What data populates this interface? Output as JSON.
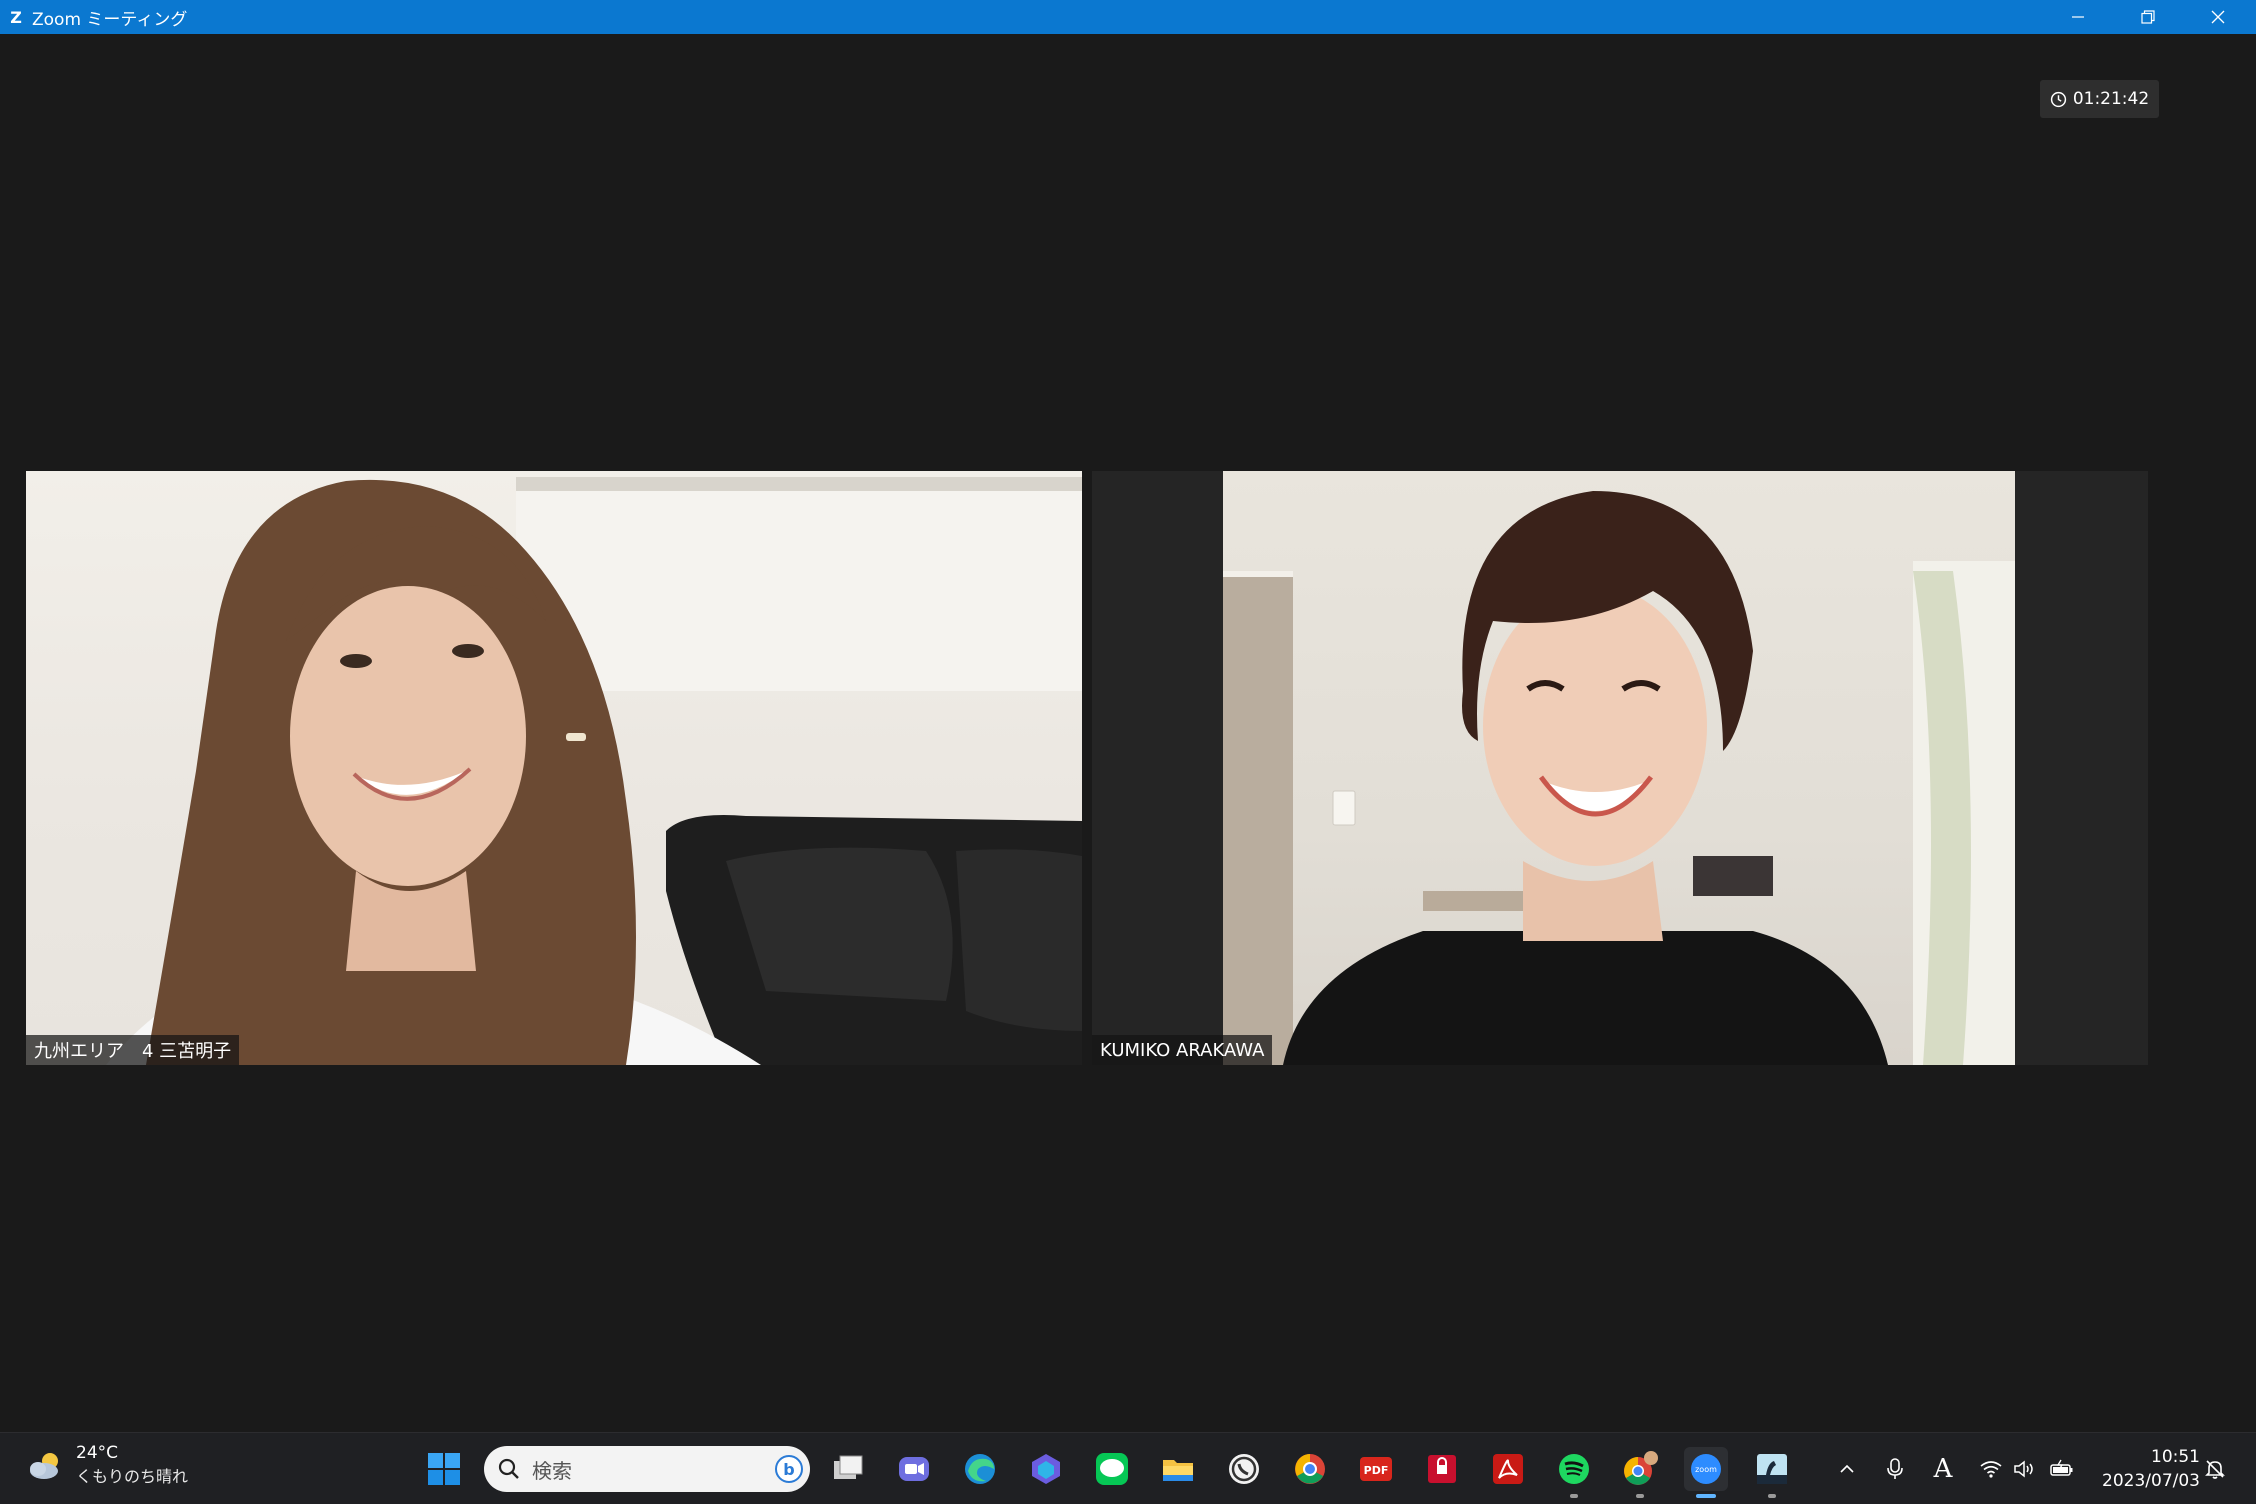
{
  "window": {
    "app_logo": "Z",
    "title": "Zoom ミーティング"
  },
  "meeting": {
    "timer": "01:21:42",
    "participants": [
      {
        "name": "九州エリア　4 三苫明子"
      },
      {
        "name": "KUMIKO ARAKAWA"
      }
    ]
  },
  "taskbar": {
    "weather": {
      "temp": "24°C",
      "condition": "くもりのち晴れ"
    },
    "search_placeholder": "検索",
    "clock": {
      "time": "10:51",
      "date": "2023/07/03"
    },
    "ime_indicator": "A",
    "apps": [
      "start",
      "search",
      "task-view",
      "teams",
      "edge",
      "copilot",
      "line",
      "file-explorer",
      "whatsapp",
      "chrome",
      "pdf",
      "mcafee",
      "acrobat",
      "spotify",
      "chrome-profile",
      "zoom",
      "kindle"
    ],
    "pdf_label": "PDF",
    "zoom_label": "zoom",
    "line_label": "LINE"
  }
}
